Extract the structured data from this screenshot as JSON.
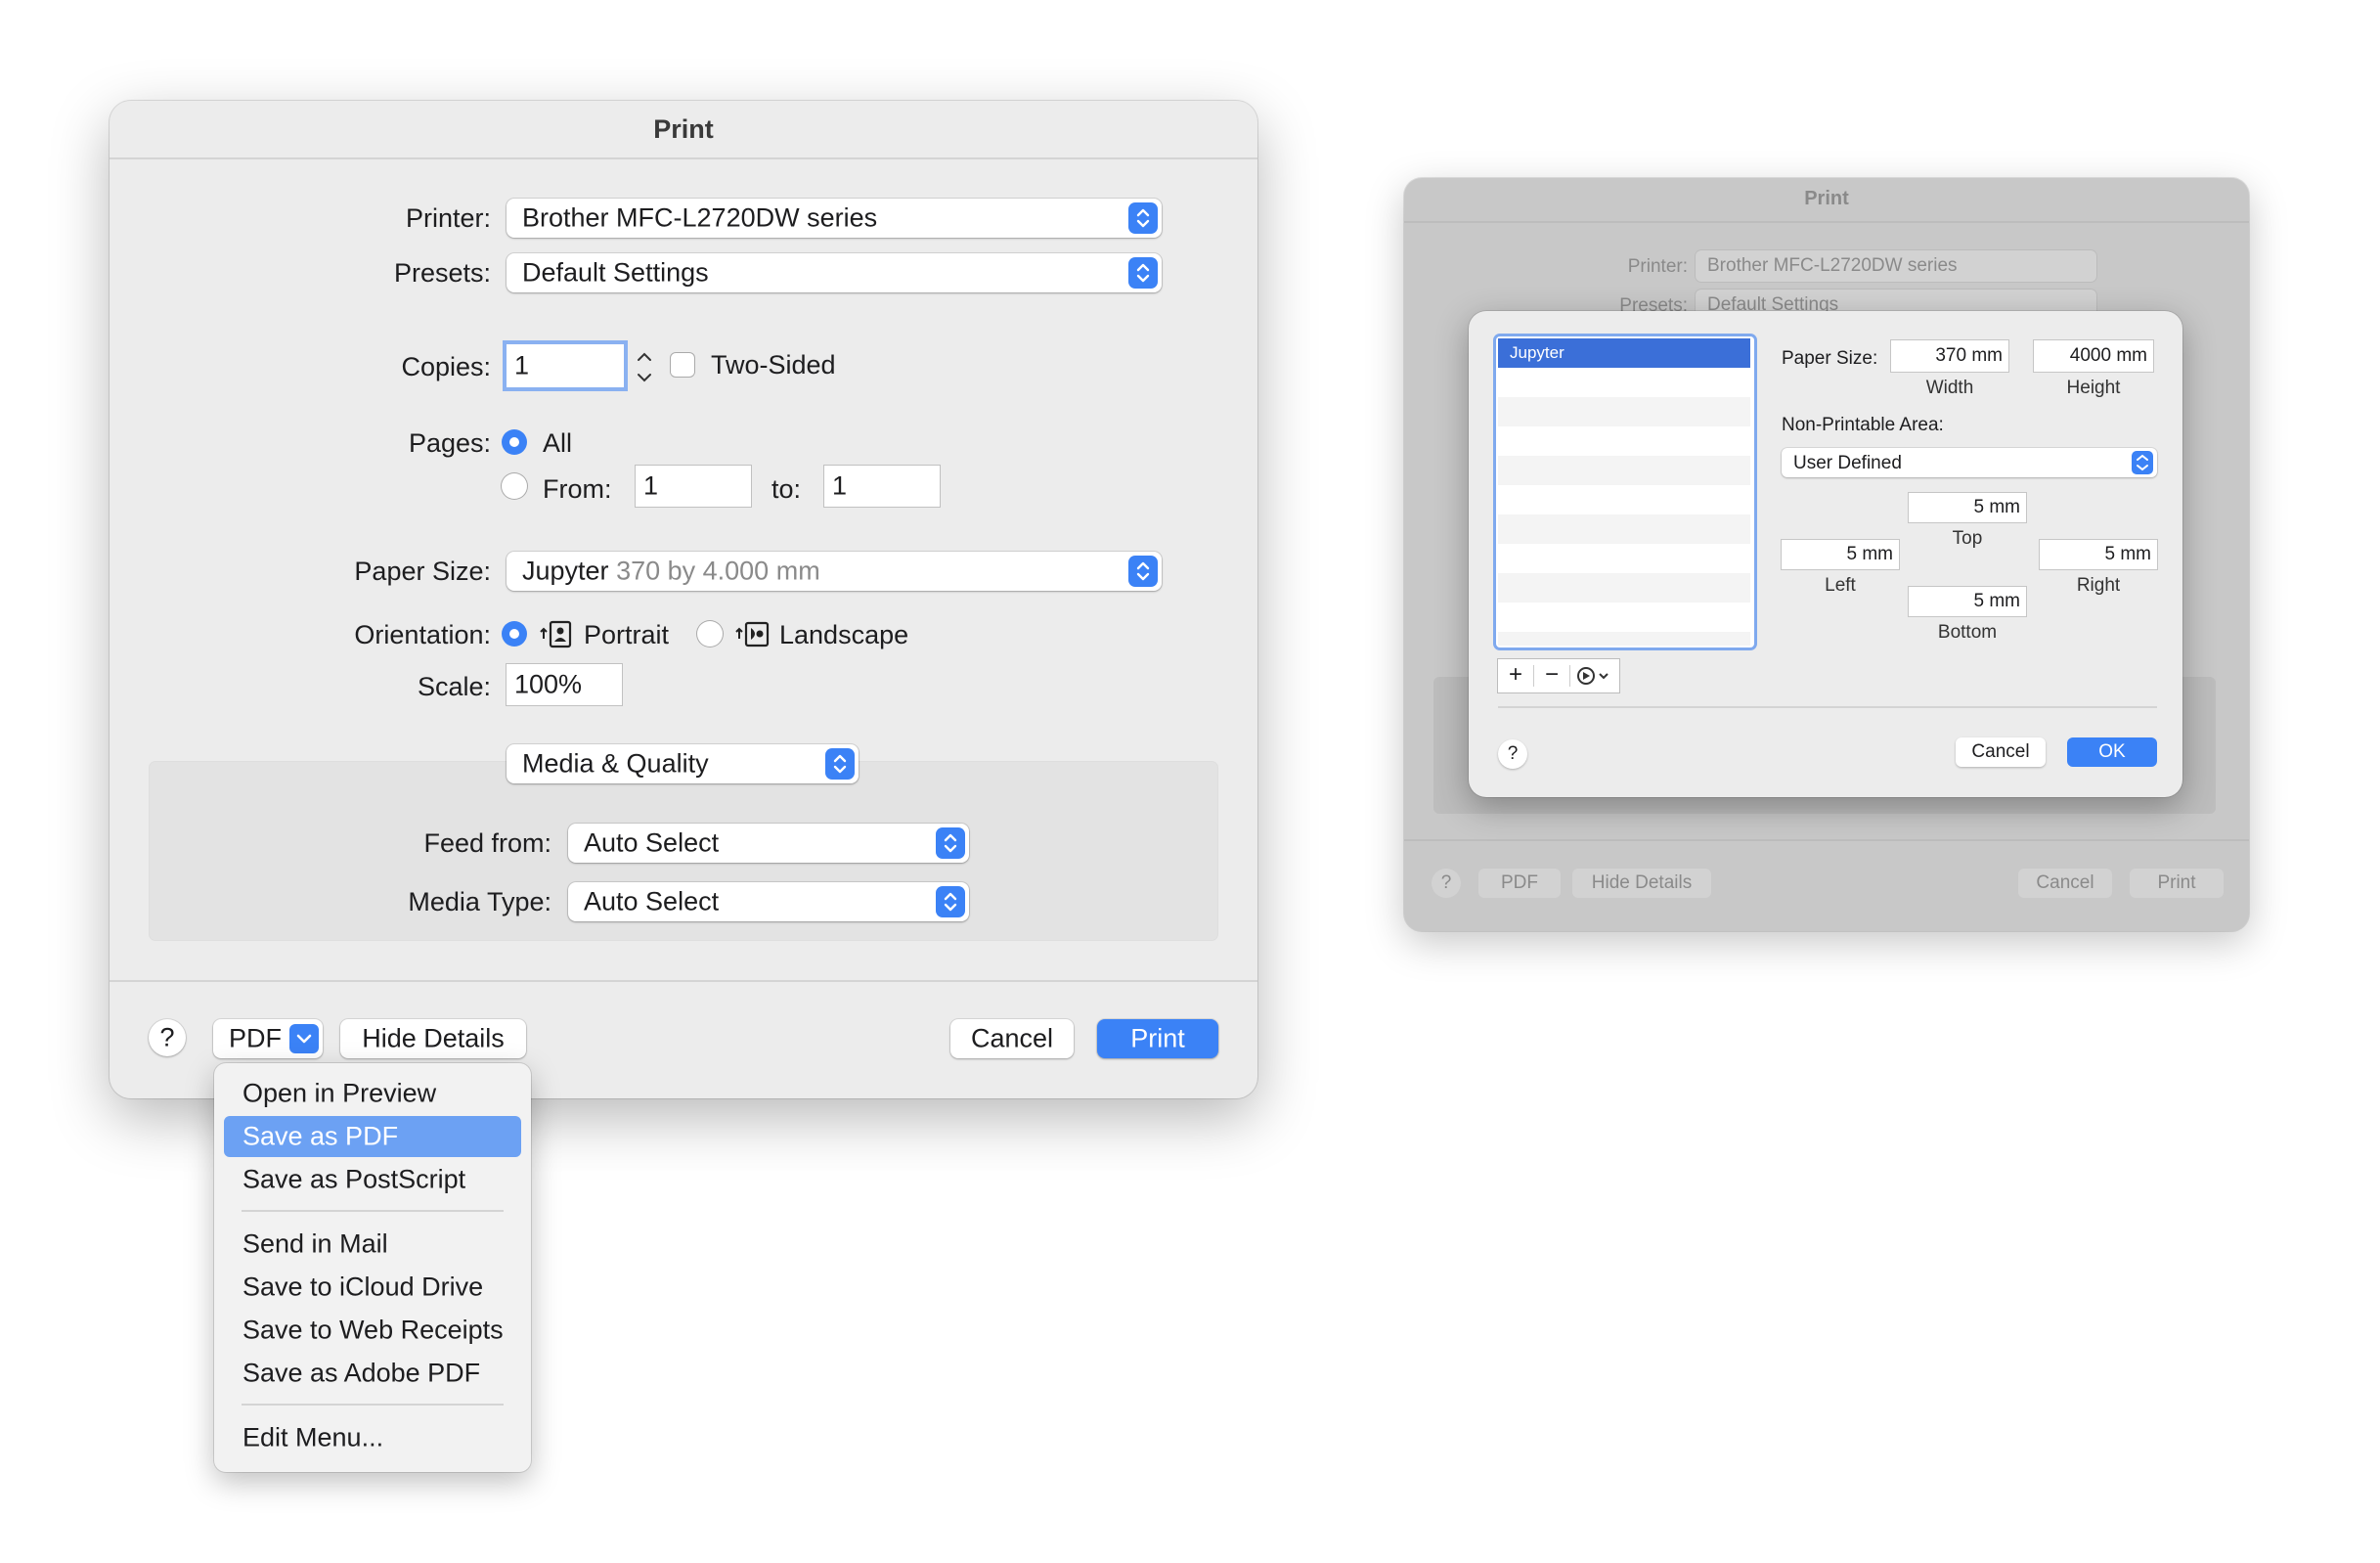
{
  "main_dialog": {
    "title": "Print",
    "printer_label": "Printer:",
    "printer_value": "Brother MFC-L2720DW series",
    "presets_label": "Presets:",
    "presets_value": "Default Settings",
    "copies_label": "Copies:",
    "copies_value": "1",
    "two_sided_label": "Two-Sided",
    "two_sided_checked": false,
    "pages_label": "Pages:",
    "pages_all_label": "All",
    "pages_from_label": "From:",
    "pages_from_value": "1",
    "pages_to_label": "to:",
    "pages_to_value": "1",
    "paper_size_label": "Paper Size:",
    "paper_size_name": "Jupyter",
    "paper_size_dims": "370 by 4.000 mm",
    "orientation_label": "Orientation:",
    "portrait_label": "Portrait",
    "landscape_label": "Landscape",
    "scale_label": "Scale:",
    "scale_value": "100%",
    "section_popup": "Media & Quality",
    "feed_from_label": "Feed from:",
    "feed_from_value": "Auto Select",
    "media_type_label": "Media Type:",
    "media_type_value": "Auto Select",
    "help_label": "?",
    "pdf_label": "PDF",
    "hide_details_label": "Hide Details",
    "cancel_label": "Cancel",
    "print_label": "Print"
  },
  "pdf_menu": {
    "items": [
      {
        "label": "Open in Preview",
        "selected": false
      },
      {
        "label": "Save as PDF",
        "selected": true
      },
      {
        "label": "Save as PostScript",
        "selected": false
      },
      {
        "label": "Send in Mail",
        "selected": false
      },
      {
        "label": "Save to iCloud Drive",
        "selected": false
      },
      {
        "label": "Save to Web Receipts",
        "selected": false
      },
      {
        "label": "Save as Adobe PDF",
        "selected": false
      },
      {
        "label": "Edit Menu...",
        "selected": false
      }
    ]
  },
  "bg_dialog": {
    "title": "Print",
    "printer_label": "Printer:",
    "printer_value": "Brother MFC-L2720DW series",
    "presets_label": "Presets:",
    "presets_value": "Default Settings",
    "help_label": "?",
    "pdf_label": "PDF",
    "hide_details_label": "Hide Details",
    "cancel_label": "Cancel",
    "print_label": "Print"
  },
  "paper_sheet": {
    "list_items": [
      "Jupyter"
    ],
    "paper_size_label": "Paper Size:",
    "width_value": "370 mm",
    "width_label": "Width",
    "height_value": "4000 mm",
    "height_label": "Height",
    "non_printable_label": "Non-Printable Area:",
    "non_printable_value": "User Defined",
    "top_value": "5 mm",
    "top_label": "Top",
    "left_value": "5 mm",
    "left_label": "Left",
    "right_value": "5 mm",
    "right_label": "Right",
    "bottom_value": "5 mm",
    "bottom_label": "Bottom",
    "add_label": "+",
    "remove_label": "−",
    "help_label": "?",
    "cancel_label": "Cancel",
    "ok_label": "OK"
  },
  "colors": {
    "accent": "#3b82f6",
    "menu_highlight": "#6ca1f3",
    "dialog_bg": "#ececec"
  }
}
